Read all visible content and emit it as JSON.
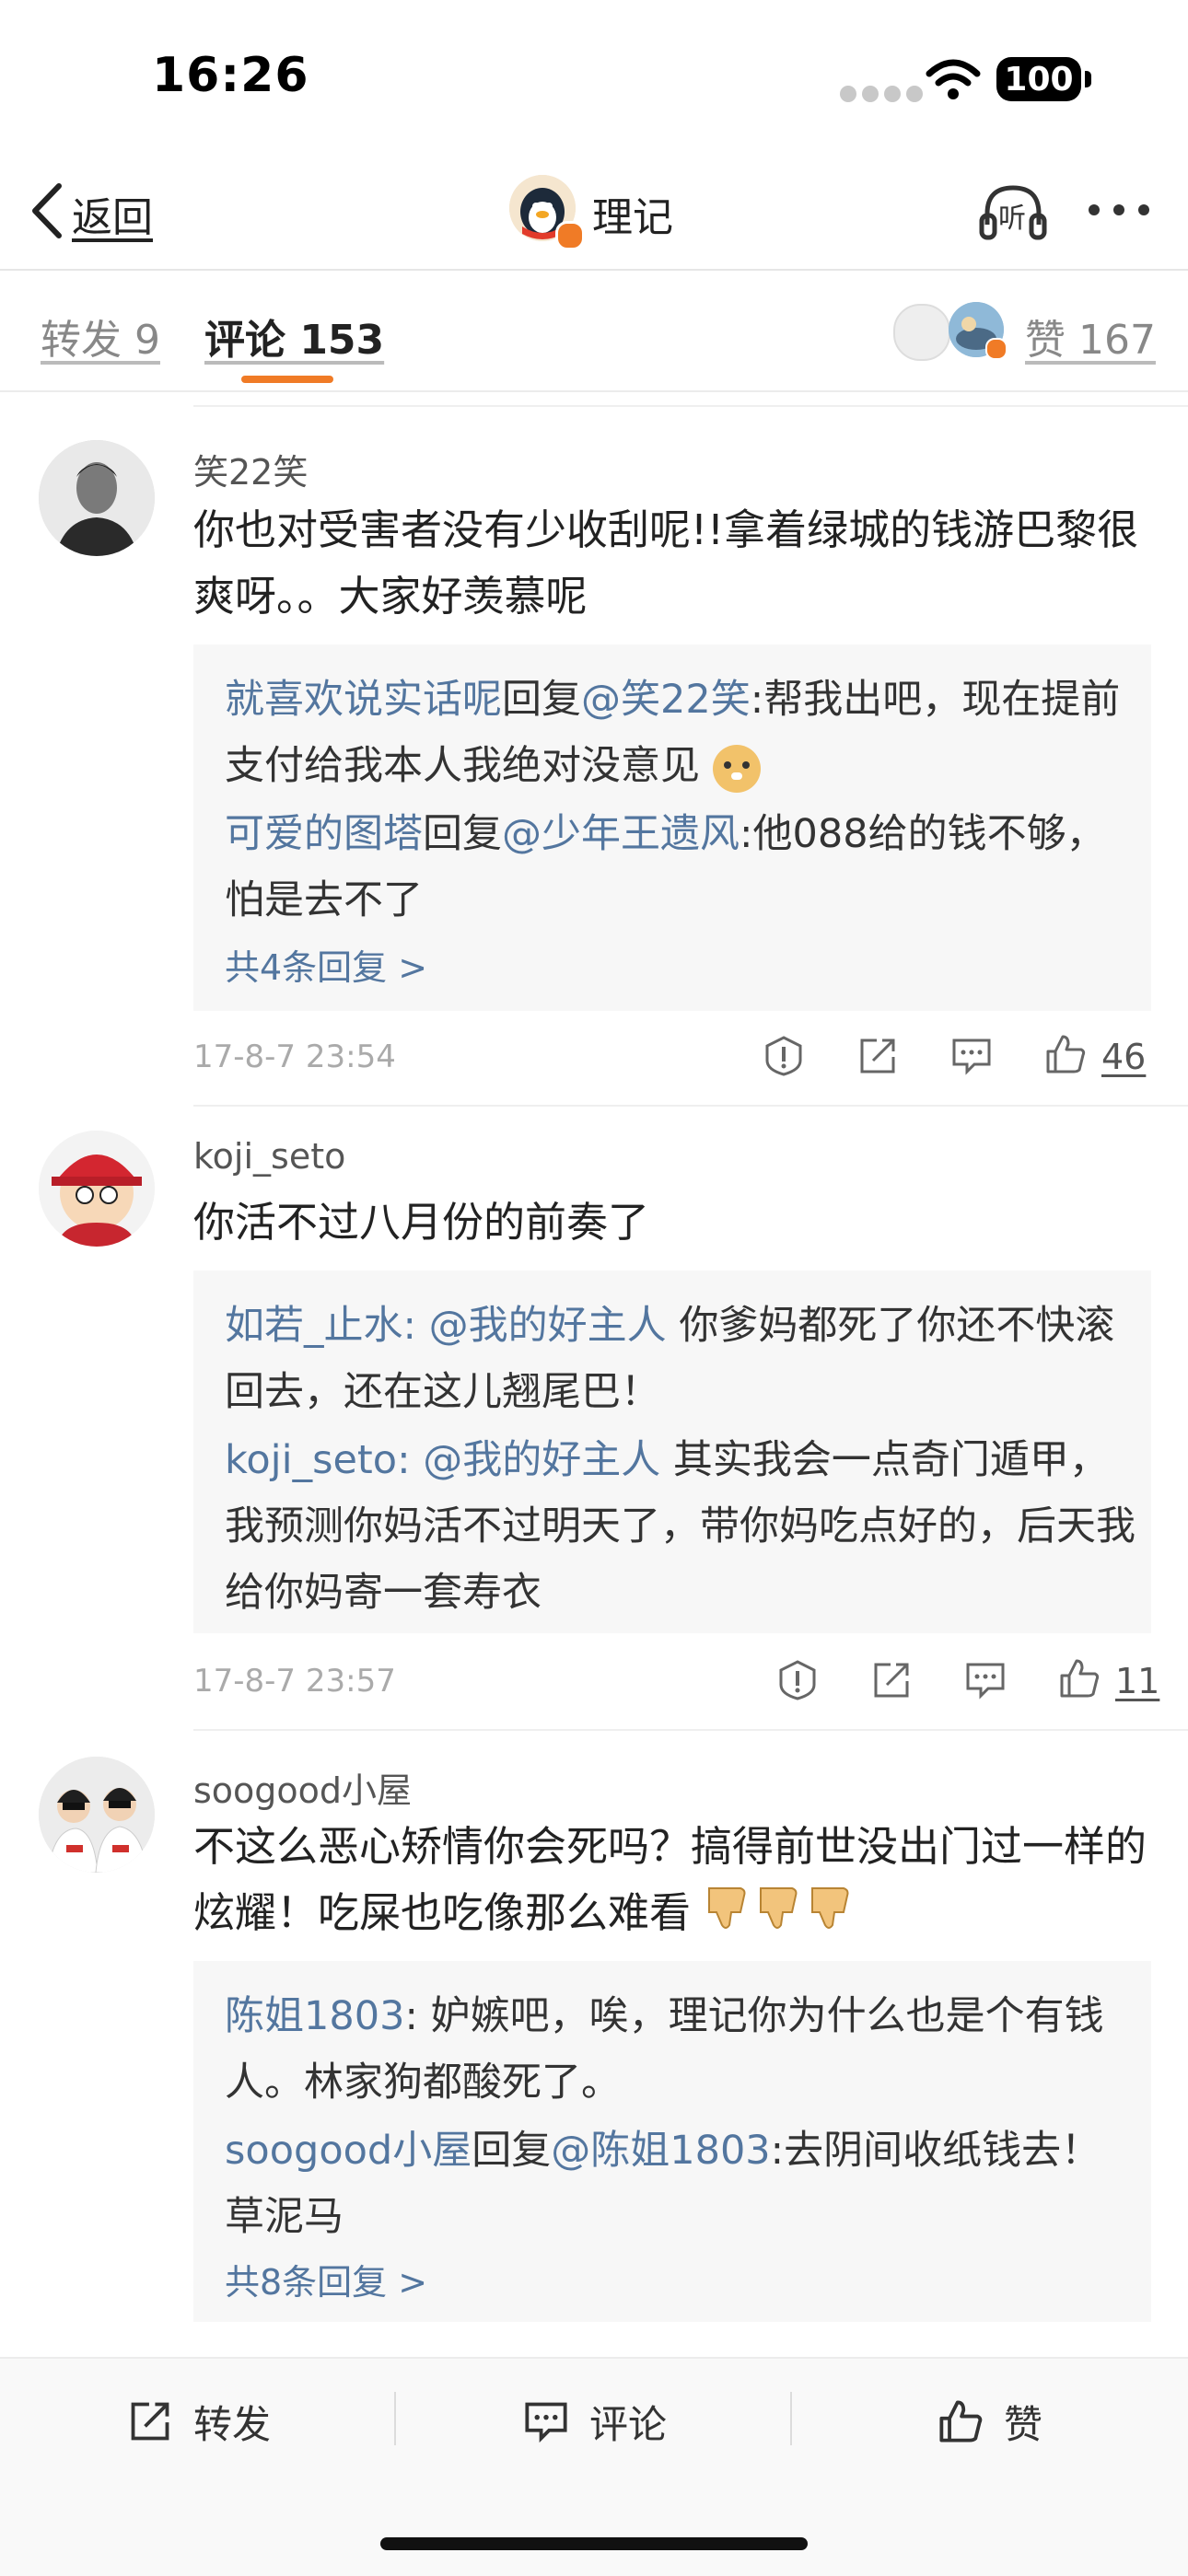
{
  "status": {
    "time": "16:26",
    "battery": "100"
  },
  "nav": {
    "back_label": "返回",
    "author": "理记",
    "listen_label": "听"
  },
  "tabs": {
    "repost": "转发 9",
    "comment": "评论 153",
    "like": "赞 167"
  },
  "comments": [
    {
      "name": "笑22笑",
      "text": "你也对受害者没有少收刮呢!!拿着绿城的钱游巴黎很爽呀。。大家好羡慕呢",
      "replies": [
        {
          "user": "就喜欢说实话呢",
          "verb": "回复",
          "target": "@笑22笑",
          "sep": ":",
          "text": "帮我出吧，现在提前支付给我本人我绝对没意见"
        },
        {
          "user": "可爱的图塔",
          "verb": "回复",
          "target": "@少年王遗风",
          "sep": ":",
          "text": "他088给的钱不够，怕是去不了"
        }
      ],
      "more": "共4条回复 >",
      "time": "17-8-7 23:54",
      "likes": "46"
    },
    {
      "name": "koji_seto",
      "text": "你活不过八月份的前奏了",
      "replies": [
        {
          "user": "如若_止水",
          "verb": "",
          "target": ": @我的好主人",
          "sep": "",
          "text": " 你爹妈都死了你还不快滚回去，还在这儿翘尾巴！"
        },
        {
          "user": "koji_seto",
          "verb": "",
          "target": ": @我的好主人",
          "sep": "",
          "text": " 其实我会一点奇门遁甲，我预测你妈活不过明天了，带你妈吃点好的，后天我给你妈寄一套寿衣"
        }
      ],
      "more": "",
      "time": "17-8-7 23:57",
      "likes": "11"
    },
    {
      "name": "soogood小屋",
      "text": "不这么恶心矫情你会死吗？搞得前世没出门过一样的炫耀！吃屎也吃像那么难看",
      "replies": [
        {
          "user": "陈姐1803",
          "verb": "",
          "target": "",
          "sep": ":",
          "text": " 妒嫉吧，唉，理记你为什么也是个有钱人。林家狗都酸死了。"
        },
        {
          "user": "soogood小屋",
          "verb": "回复",
          "target": "@陈姐1803",
          "sep": ":",
          "text": "去阴间收纸钱去！草泥马"
        }
      ],
      "more": "共8条回复 >",
      "time": "",
      "likes": ""
    }
  ],
  "bottom_bar": {
    "repost": "转发",
    "comment": "评论",
    "like": "赞"
  },
  "colors": {
    "link": "#53769f",
    "accent": "#f07b26"
  }
}
